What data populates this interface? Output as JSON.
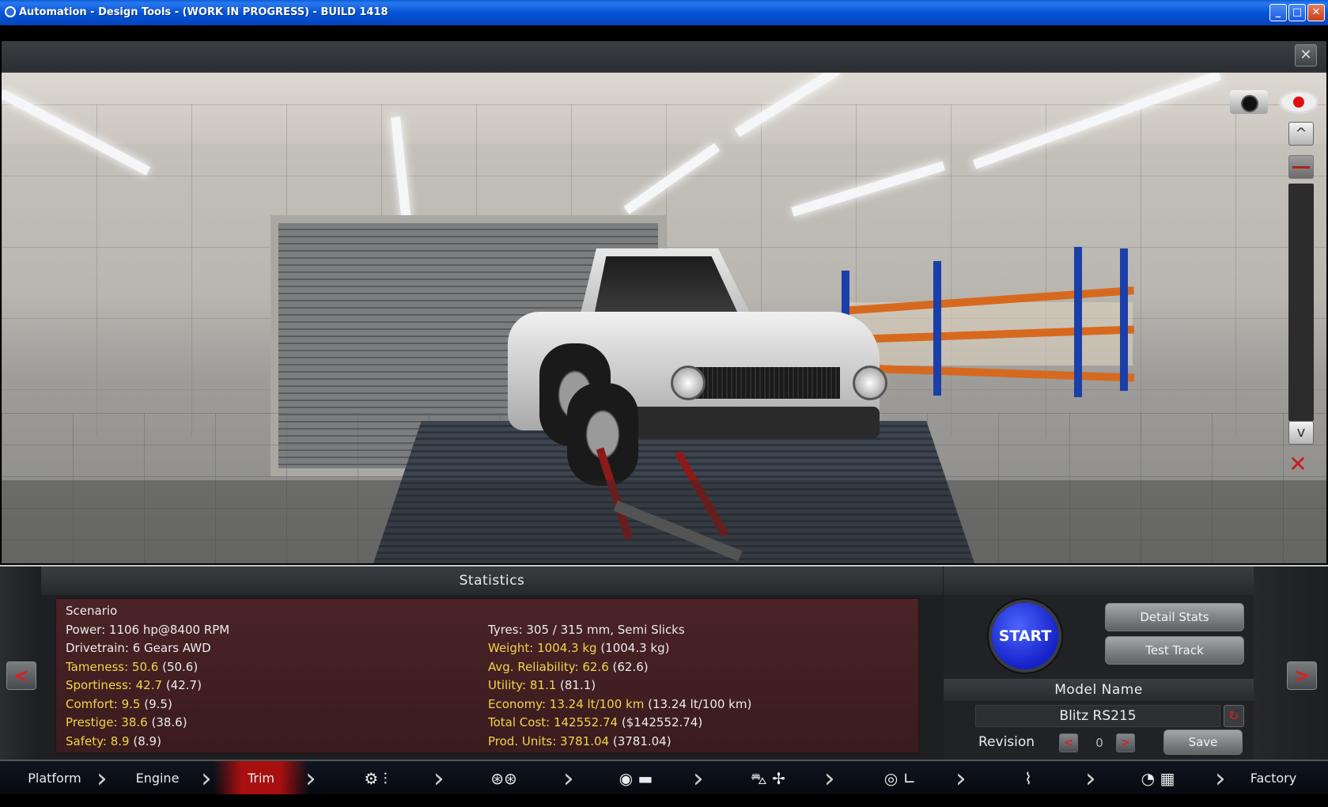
{
  "window": {
    "title": "Automation - Design Tools - (WORK IN PROGRESS) - BUILD 1418",
    "minimize": "_",
    "maximize": "□",
    "close": "✕"
  },
  "panel": {
    "close": "✕"
  },
  "viewport": {
    "up": "^",
    "down": "v",
    "icons": [
      "camera-icon",
      "eye-icon",
      "hide-icon"
    ]
  },
  "statistics": {
    "title": "Statistics",
    "left": [
      {
        "key": "Scenario",
        "value": "",
        "highlight": false
      },
      {
        "key": "Power: 1106 hp@8400 RPM",
        "value": "",
        "highlight": false
      },
      {
        "key": "Drivetrain: 6 Gears AWD",
        "value": "",
        "highlight": false
      },
      {
        "key": "Tameness: 50.6",
        "value": "(50.6)",
        "highlight": true
      },
      {
        "key": "Sportiness: 42.7",
        "value": "(42.7)",
        "highlight": true
      },
      {
        "key": "Comfort: 9.5",
        "value": "(9.5)",
        "highlight": true
      },
      {
        "key": "Prestige: 38.6",
        "value": "(38.6)",
        "highlight": true
      },
      {
        "key": "Safety: 8.9",
        "value": "(8.9)",
        "highlight": true
      }
    ],
    "right": [
      {
        "key": "",
        "value": "",
        "highlight": false
      },
      {
        "key": "Tyres: 305 / 315 mm, Semi Slicks",
        "value": "",
        "highlight": false
      },
      {
        "key": "Weight: 1004.3 kg",
        "value": "(1004.3 kg)",
        "highlight": true
      },
      {
        "key": "Avg. Reliability: 62.6",
        "value": "(62.6)",
        "highlight": true
      },
      {
        "key": "Utility: 81.1",
        "value": "(81.1)",
        "highlight": true
      },
      {
        "key": "Economy: 13.24 lt/100 km",
        "value": "(13.24 lt/100 km)",
        "highlight": true
      },
      {
        "key": "Total Cost: 142552.74",
        "value": "($142552.74)",
        "highlight": true
      },
      {
        "key": "Prod. Units: 3781.04",
        "value": "(3781.04)",
        "highlight": true
      }
    ],
    "prev": "<",
    "next": ">"
  },
  "actions": {
    "start": "START",
    "detail_stats": "Detail Stats",
    "test_track": "Test Track",
    "model_name_label": "Model Name",
    "model_name": "Blitz RS215",
    "revision_label": "Revision",
    "revision": "0",
    "rev_prev": "<",
    "rev_next": ">",
    "save": "Save"
  },
  "nav": {
    "items": [
      "Platform",
      "Engine",
      "Trim",
      "Factory"
    ],
    "active": "Trim",
    "separator": "›"
  }
}
